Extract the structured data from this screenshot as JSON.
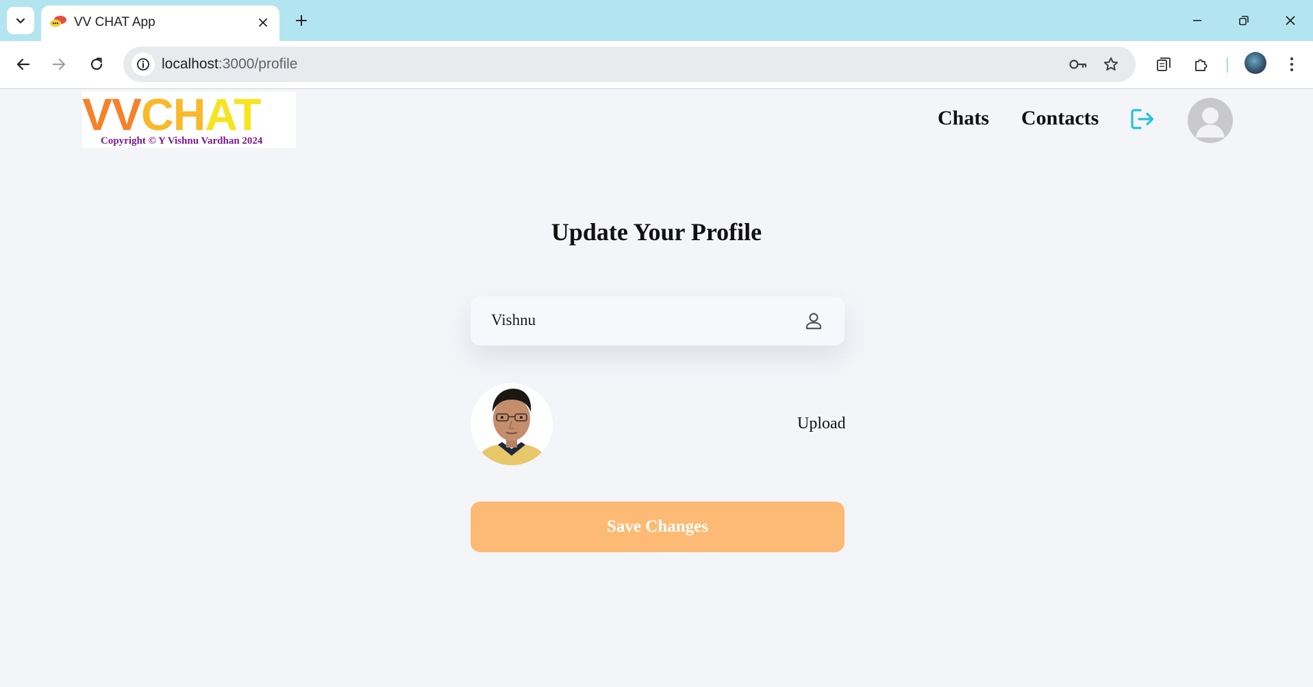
{
  "browser": {
    "tab_title": "VV CHAT App",
    "url_host": "localhost",
    "url_path": ":3000/profile",
    "icons": [
      "tab-search-icon",
      "close-icon",
      "plus-icon",
      "minimize-icon",
      "restore-icon",
      "close-window-icon",
      "back-arrow-icon",
      "forward-arrow-icon",
      "reload-icon",
      "info-icon",
      "key-icon",
      "star-icon",
      "tab-groups-icon",
      "extensions-icon",
      "profile-avatar-icon",
      "more-vert-icon"
    ]
  },
  "header": {
    "logo": {
      "letters": [
        "VV",
        "CH",
        "AT"
      ],
      "copyright": "Copyright © Y Vishnu Vardhan 2024"
    },
    "nav": {
      "chats_label": "Chats",
      "contacts_label": "Contacts"
    },
    "logout_icon": "logout-icon",
    "avatar_icon": "default-user-avatar"
  },
  "main": {
    "title": "Update Your Profile",
    "name_value": "Vishnu",
    "name_icon": "user-outline-icon",
    "photo": "profile-photo",
    "upload_label": "Upload",
    "save_label": "Save Changes"
  },
  "colors": {
    "tabbar": "#b3e5f0",
    "page_bg": "#f4f5f9",
    "accent_orange": "#fdba74",
    "logout_cyan": "#22c3d6",
    "logo_orange": "#f5822a",
    "logo_yellow": "#f7e41f",
    "copyright_purple": "#7a1a8a"
  }
}
